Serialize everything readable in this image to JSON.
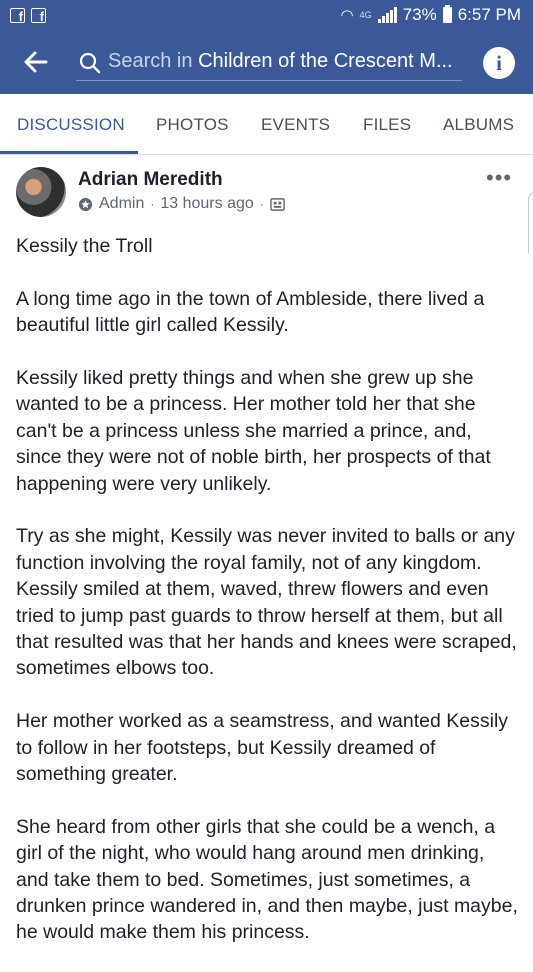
{
  "status_bar": {
    "left_icons": [
      "facebook-notification-icon",
      "facebook-notification-icon"
    ],
    "network": "4G",
    "battery": "73%",
    "time": "6:57 PM"
  },
  "search": {
    "prefix": "Search in ",
    "group": "Children of the Crescent M..."
  },
  "tabs": [
    "DISCUSSION",
    "PHOTOS",
    "EVENTS",
    "FILES",
    "ALBUMS"
  ],
  "active_tab": "DISCUSSION",
  "post": {
    "author": "Adrian Meredith",
    "role": "Admin",
    "time": "13 hours ago",
    "separator": "·",
    "more": "•••",
    "paragraphs": [
      "Kessily the Troll",
      "A long time ago in the town of Ambleside, there lived a beautiful little girl called Kessily.",
      "Kessily liked pretty things and when she grew up she wanted to be a princess. Her mother told her that she can't be a princess unless she married a prince, and, since they were not of noble birth, her prospects of that happening were very unlikely.",
      "Try as she might, Kessily was never invited to balls or any function involving the royal family, not of any kingdom. Kessily smiled at them, waved, threw flowers and even tried to jump past guards to throw herself at them, but all that resulted was that her hands and knees were scraped, sometimes elbows too.",
      "Her mother worked as a seamstress, and wanted Kessily to follow in her footsteps, but Kessily dreamed of something greater.",
      "She heard from other girls that she could be a wench, a girl of the night, who would hang around men drinking, and take them to bed. Sometimes, just sometimes, a drunken prince wandered in, and then maybe, just maybe, he would make them his princess."
    ]
  },
  "colors": {
    "brand": "#3b5998",
    "text": "#1d2129",
    "secondary": "#606770"
  }
}
